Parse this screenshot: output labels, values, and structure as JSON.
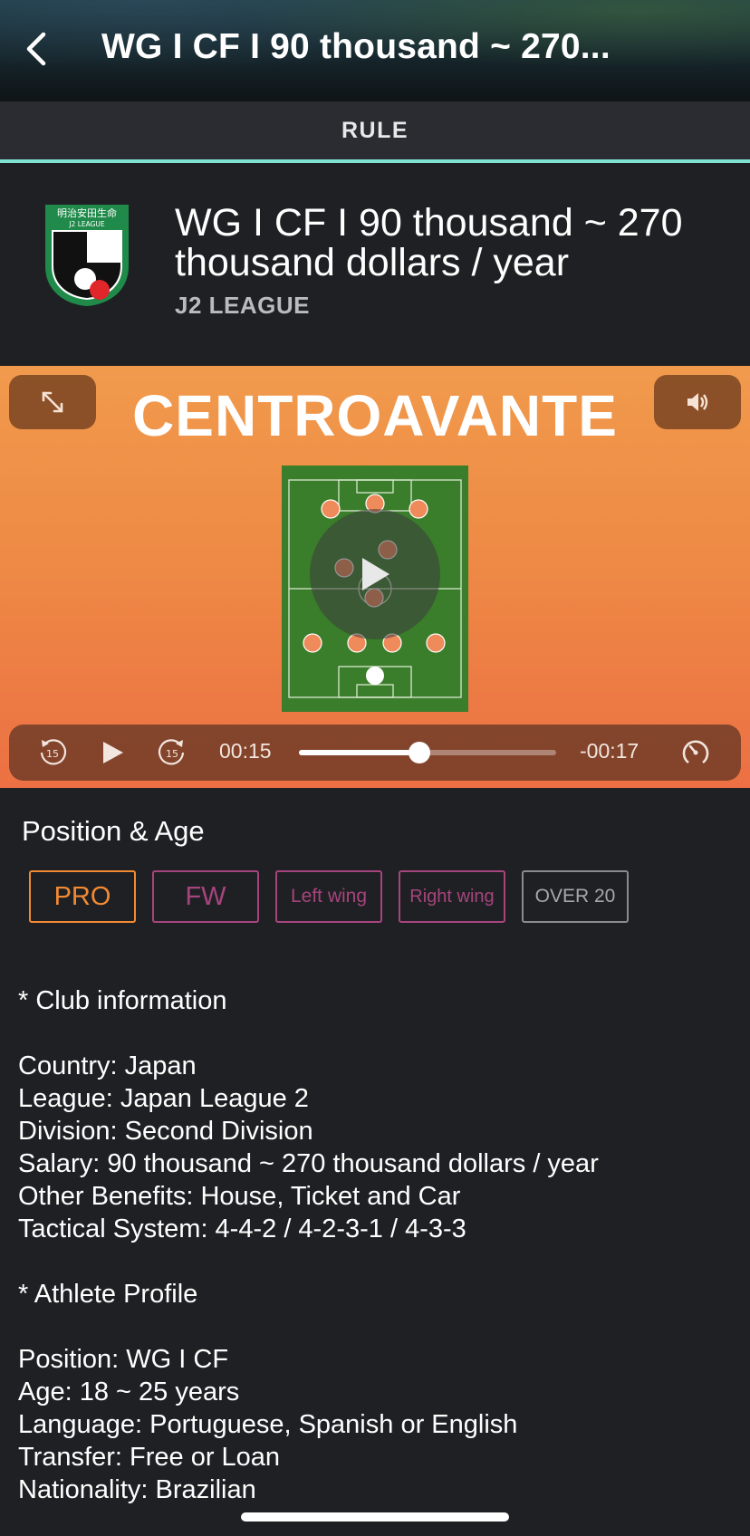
{
  "header": {
    "title": "WG I CF I 90 thousand ~ 270...",
    "back_icon": "chevron-left-icon"
  },
  "tabs": {
    "active": "RULE"
  },
  "job": {
    "title": "WG I CF I 90 thousand ~ 270 thousand dollars / year",
    "league": "J2 LEAGUE",
    "crest": {
      "top_text": "明治安田生命",
      "sub_text": "J2 LEAGUE",
      "colors": {
        "green": "#1f8a4a",
        "black": "#111111",
        "red": "#e0262b"
      }
    }
  },
  "video": {
    "heading": "CENTROAVANTE",
    "expand_icon": "expand-icon",
    "sound_icon": "speaker-icon",
    "play_icon": "play-icon",
    "elapsed": "00:15",
    "remaining": "-00:17",
    "progress": 0.47,
    "skip_back_label": "15",
    "skip_forward_label": "15",
    "speed_icon": "playback-speed-icon",
    "colors": {
      "bg_top": "#f19a4c",
      "bg_bottom": "#ec7043",
      "pitch": "#3a7d2a",
      "player": "#ef8a5a"
    }
  },
  "position_age": {
    "title": "Position & Age",
    "tags": [
      {
        "label": "PRO",
        "color": "#f28a33"
      },
      {
        "label": "FW",
        "color": "#a6447e"
      },
      {
        "label": "Left wing",
        "color": "#a6447e"
      },
      {
        "label": "Right wing",
        "color": "#a6447e"
      },
      {
        "label": "OVER 20",
        "color": "#8a8b8f"
      }
    ]
  },
  "description": {
    "club_heading": "* Club information",
    "club_lines": [
      "Country: Japan",
      "League: Japan League 2",
      "Division: Second Division",
      "Salary: 90 thousand ~ 270 thousand dollars / year",
      "Other Benefits: House, Ticket and Car",
      "Tactical System: 4-4-2 / 4-2-3-1 / 4-3-3"
    ],
    "athlete_heading": "* Athlete Profile",
    "athlete_lines": [
      "Position: WG I CF",
      "Age: 18 ~ 25 years",
      "Language: Portuguese, Spanish or English",
      "Transfer: Free or Loan",
      "Nationality: Brazilian"
    ]
  }
}
